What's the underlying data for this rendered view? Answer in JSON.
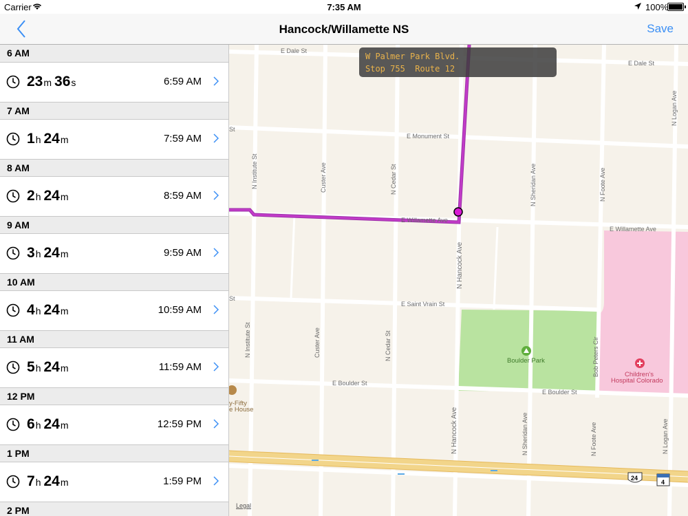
{
  "status_bar": {
    "carrier": "Carrier",
    "time": "7:35 AM",
    "battery": "100%"
  },
  "nav": {
    "title": "Hancock/Willamette NS",
    "save_label": "Save",
    "accent_color": "#3b8ff5"
  },
  "departures": [
    {
      "hour": "6 AM",
      "duration": [
        [
          "23",
          "m"
        ],
        [
          "36",
          "s"
        ]
      ],
      "departs": "6:59 AM"
    },
    {
      "hour": "7 AM",
      "duration": [
        [
          "1",
          "h"
        ],
        [
          "24",
          "m"
        ]
      ],
      "departs": "7:59 AM"
    },
    {
      "hour": "8 AM",
      "duration": [
        [
          "2",
          "h"
        ],
        [
          "24",
          "m"
        ]
      ],
      "departs": "8:59 AM"
    },
    {
      "hour": "9 AM",
      "duration": [
        [
          "3",
          "h"
        ],
        [
          "24",
          "m"
        ]
      ],
      "departs": "9:59 AM"
    },
    {
      "hour": "10 AM",
      "duration": [
        [
          "4",
          "h"
        ],
        [
          "24",
          "m"
        ]
      ],
      "departs": "10:59 AM"
    },
    {
      "hour": "11 AM",
      "duration": [
        [
          "5",
          "h"
        ],
        [
          "24",
          "m"
        ]
      ],
      "departs": "11:59 AM"
    },
    {
      "hour": "12 PM",
      "duration": [
        [
          "6",
          "h"
        ],
        [
          "24",
          "m"
        ]
      ],
      "departs": "12:59 PM"
    },
    {
      "hour": "1 PM",
      "duration": [
        [
          "7",
          "h"
        ],
        [
          "24",
          "m"
        ]
      ],
      "departs": "1:59 PM"
    },
    {
      "hour": "2 PM",
      "duration": null,
      "departs": null
    }
  ],
  "map": {
    "tooltip": {
      "line1": "W Palmer Park Blvd.",
      "stop": "Stop 755",
      "route": "Route 12"
    },
    "streets": {
      "dale_top": "E Dale St",
      "dale_right": "E Dale St",
      "monument": "E Monument St",
      "st_left": "St",
      "willamette_left": "E Willamette Ave",
      "willamette_right": "E Willamette Ave",
      "saint_vrain": "E Saint Vrain St",
      "st_left2": "St",
      "boulder_left": "E Boulder St",
      "boulder_right": "E Boulder St",
      "institute_top": "N Institute St",
      "institute_bottom": "N Institute St",
      "custer_top": "Custer Ave",
      "custer_bottom": "Custer Ave",
      "cedar_top": "N Cedar St",
      "cedar_bottom": "N Cedar St",
      "hancock_mid": "N Hancock Ave",
      "hancock_bottom": "N Hancock Ave",
      "sheridan_top": "N Sheridan Ave",
      "sheridan_bottom": "N Sheridan Ave",
      "foote_top": "N Foote Ave",
      "foote_bottom": "N Foote Ave",
      "logan_top": "N Logan Ave",
      "logan_bottom": "N Logan Ave",
      "bob_peters": "Bob Peters Cir"
    },
    "pois": {
      "park": "Boulder Park",
      "hospital_line1": "Children's",
      "hospital_line2": "Hospital Colorado",
      "fifty_line1": "y-Fifty",
      "fifty_line2": "e House"
    },
    "shields": {
      "us": "24",
      "state": "4"
    },
    "legal": "Legal",
    "route_color": "#c23bc8",
    "park_color": "#b9e3a0",
    "hospital_color": "#f8c8dc"
  }
}
